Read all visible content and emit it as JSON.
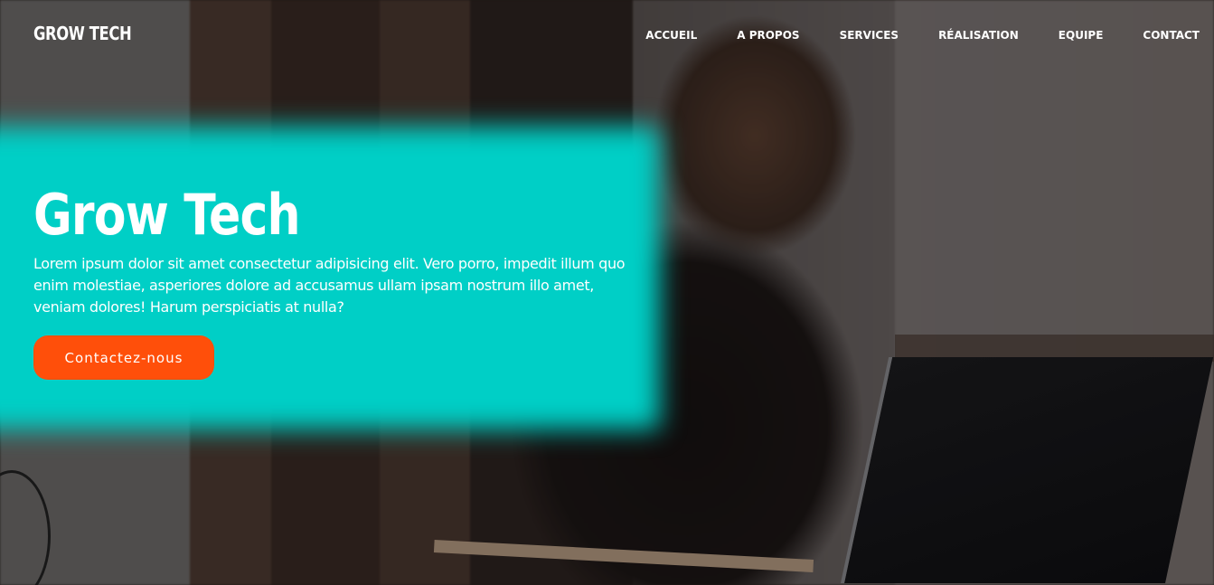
{
  "header": {
    "logo": "GROW TECH",
    "nav": [
      {
        "label": "ACCUEIL"
      },
      {
        "label": "A PROPOS"
      },
      {
        "label": "SERVICES"
      },
      {
        "label": "RÉALISATION"
      },
      {
        "label": "EQUIPE"
      },
      {
        "label": "CONTACT"
      }
    ]
  },
  "hero": {
    "title": "Grow Tech",
    "description": "Lorem ipsum dolor sit amet consectetur adipisicing elit. Vero porro, impedit illum quo enim molestiae, asperiores dolore ad accusamus ullam ipsam nostrum illo amet, veniam dolores! Harum perspiciatis at nulla?",
    "cta_label": "Contactez-nous",
    "background_image": "woman-with-laptop-photo"
  },
  "colors": {
    "accent_teal": "#00cfc6",
    "cta_orange": "#ff4f0a",
    "text": "#ffffff"
  }
}
